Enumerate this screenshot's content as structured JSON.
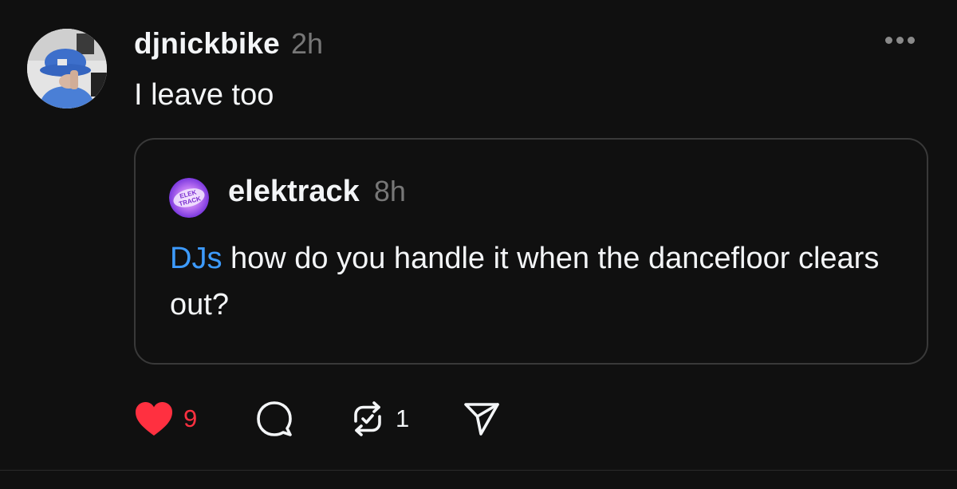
{
  "post": {
    "username": "djnickbike",
    "time": "2h",
    "text": "I leave too",
    "avatar_icon": "user-avatar-blue-bucket-hat"
  },
  "quoted_post": {
    "username": "elektrack",
    "time": "8h",
    "mention": "DJs",
    "text": " how do you handle it when the dancefloor clears out?",
    "avatar_icon": "elektrack-logo-avatar",
    "avatar_logo_text": "ELEK TRACK"
  },
  "actions": {
    "likes": "9",
    "reposts": "1",
    "like_icon": "heart-icon",
    "comment_icon": "comment-icon",
    "repost_icon": "repost-icon",
    "share_icon": "send-icon"
  },
  "colors": {
    "background": "#101010",
    "like_red": "#ff3040",
    "mention_blue": "#3d9bff",
    "muted_gray": "#777777",
    "border": "#393939"
  }
}
